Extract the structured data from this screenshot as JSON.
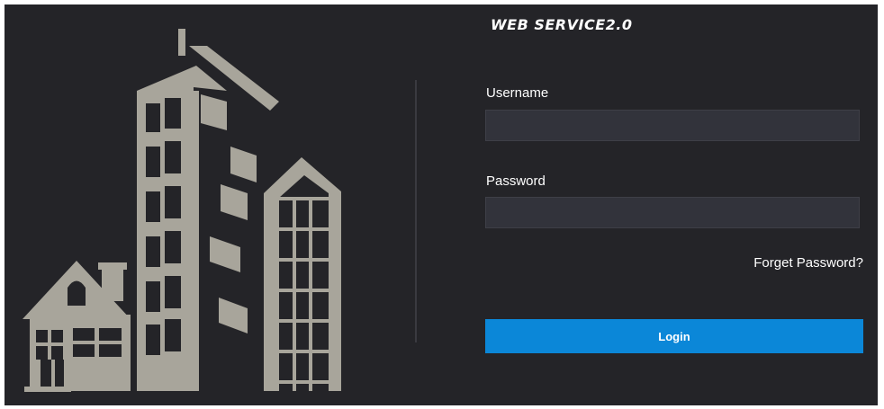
{
  "brand": {
    "title": "WEB SERVICE2.0"
  },
  "login_form": {
    "username_label": "Username",
    "username_value": "",
    "password_label": "Password",
    "password_value": "",
    "forget_password_link": "Forget Password?",
    "login_button": "Login"
  },
  "colors": {
    "background": "#242428",
    "illustration": "#a8a59b",
    "input_bg": "#32333b",
    "accent": "#0b87d8"
  },
  "illustration": {
    "name": "buildings-and-house-illustration"
  }
}
